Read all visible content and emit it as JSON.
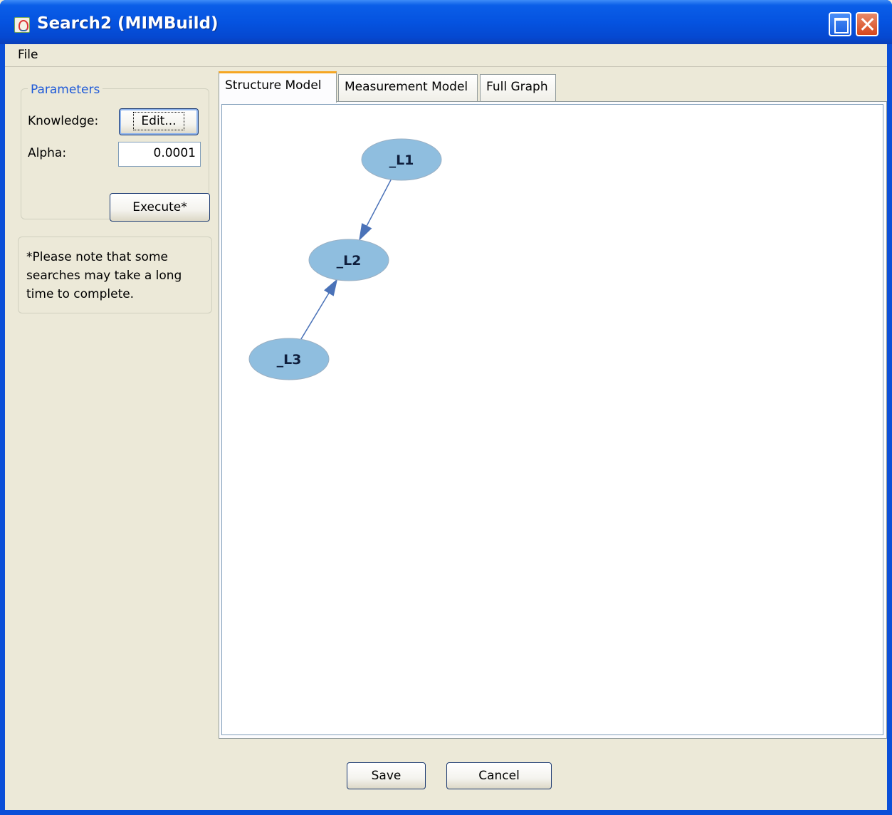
{
  "window": {
    "title": "Search2 (MIMBuild)"
  },
  "menu": {
    "file": "File"
  },
  "parameters": {
    "legend": "Parameters",
    "knowledge_label": "Knowledge:",
    "edit_label": "Edit...",
    "alpha_label": "Alpha:",
    "alpha_value": "0.0001"
  },
  "execute_label": "Execute*",
  "note": "*Please note that some searches may take a long time to complete.",
  "tabs": [
    {
      "label": "Structure Model",
      "active": true
    },
    {
      "label": "Measurement Model",
      "active": false
    },
    {
      "label": "Full Graph",
      "active": false
    }
  ],
  "graph": {
    "node_color": "#8fbedf",
    "edge_color": "#4a72b8",
    "nodes": [
      {
        "id": "_L1",
        "label": "_L1"
      },
      {
        "id": "_L2",
        "label": "_L2"
      },
      {
        "id": "_L3",
        "label": "_L3"
      }
    ],
    "edges": [
      {
        "from": "_L1",
        "to": "_L2"
      },
      {
        "from": "_L3",
        "to": "_L2"
      }
    ]
  },
  "buttons": {
    "save": "Save",
    "cancel": "Cancel"
  }
}
